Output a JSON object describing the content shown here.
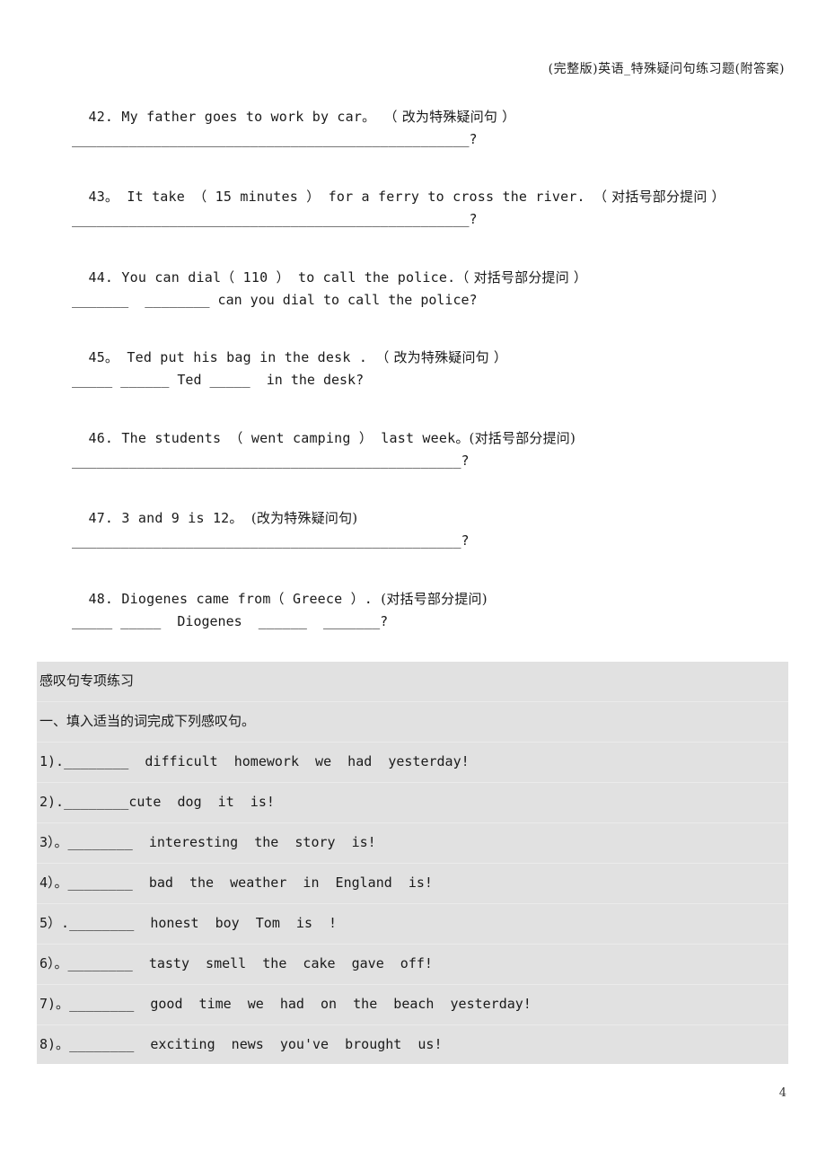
{
  "header": {
    "title": "(完整版)英语_特殊疑问句练习题(附答案)"
  },
  "questions": [
    {
      "number": "42.",
      "text": "My father goes to work by car。",
      "instruction": "（ 改为特殊疑问句 ）",
      "answer_line": "_________________________________________________?"
    },
    {
      "number": "43。",
      "text": "It take （ 15 minutes ） for a ferry to cross the river.",
      "instruction": "（ 对括号部分提问 ）",
      "answer_line": "_________________________________________________?"
    },
    {
      "number": "44.",
      "text": "You can dial（ 110 ） to call the police.",
      "instruction": "（ 对括号部分提问 ）",
      "answer_line": "_______  ________ can you dial to call the police?"
    },
    {
      "number": "45。",
      "text": "Ted put his bag in the desk .",
      "instruction": "（ 改为特殊疑问句 ）",
      "answer_line": "_____ ______ Ted _____  in the desk?"
    },
    {
      "number": "46.",
      "text": "The students （ went camping ） last week。",
      "instruction": "(对括号部分提问)",
      "answer_line": "________________________________________________?"
    },
    {
      "number": "47.",
      "text": "3 and 9 is 12。",
      "instruction": "(改为特殊疑问句)",
      "answer_line": "________________________________________________?"
    },
    {
      "number": "48.",
      "text": "Diogenes came from（ Greece ）.",
      "instruction": "(对括号部分提问)",
      "answer_line": "_____ _____  Diogenes  ______  _______?"
    }
  ],
  "exclamation_section": {
    "title": "感叹句专项练习",
    "instruction": "一、填入适当的词完成下列感叹句。",
    "items": [
      {
        "label": "1).",
        "blank": "________",
        "text": "  difficult  homework  we  had  yesterday!"
      },
      {
        "label": "2).",
        "blank": "________",
        "text": "cute  dog  it  is!"
      },
      {
        "label": "3）。",
        "blank": "________",
        "text": "  interesting  the  story  is!"
      },
      {
        "label": "4）。",
        "blank": "________",
        "text": "  bad  the  weather  in  England  is!"
      },
      {
        "label": "5）.",
        "blank": "________",
        "text": "  honest  boy  Tom  is  !"
      },
      {
        "label": "6）。",
        "blank": "________",
        "text": "  tasty  smell  the  cake  gave  off!"
      },
      {
        "label": "7)。",
        "blank": "________",
        "text": "  good  time  we  had  on  the  beach  yesterday!"
      },
      {
        "label": "8)。",
        "blank": "________",
        "text": "  exciting  news  you've  brought  us!"
      }
    ]
  },
  "footer": {
    "page_number": "4"
  },
  "colors": {
    "panel_background": "#e1e1e1",
    "text": "#1a1a1a"
  }
}
